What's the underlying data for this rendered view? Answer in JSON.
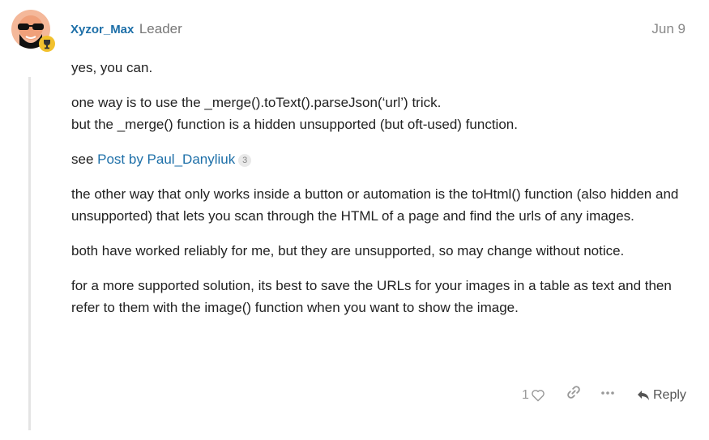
{
  "post": {
    "author": "Xyzor_Max",
    "author_title": "Leader",
    "date": "Jun 9",
    "paragraphs": {
      "p1": "yes, you can.",
      "p2_line1": "one way is to use the _merge().toText().parseJson(‘url’) trick.",
      "p2_line2": "but the _merge() function is a hidden unsupported (but oft-used) function.",
      "p3_prefix": "see ",
      "p3_link": "Post by Paul_Danyliuk",
      "p3_badge": "3",
      "p4": "the other way that only works inside a button or automation is the toHtml() function (also hidden and unsupported) that lets you scan through the HTML of a page and find the urls of any images.",
      "p5": "both have worked reliably for me, but they are unsupported, so may change without notice.",
      "p6": "for a more supported solution, its best to save the URLs for your images in a table as text and then refer to them with the image() function when you want to show the image."
    },
    "actions": {
      "like_count": "1",
      "reply_label": "Reply"
    }
  },
  "icons": {
    "avatar": "avatar-icon",
    "flair": "trophy-icon",
    "like": "heart-icon",
    "share": "link-icon",
    "more": "more-icon",
    "reply": "reply-icon"
  },
  "colors": {
    "link": "#1d6fa8",
    "meta": "#888888",
    "flair_bg": "#f2c12e"
  }
}
